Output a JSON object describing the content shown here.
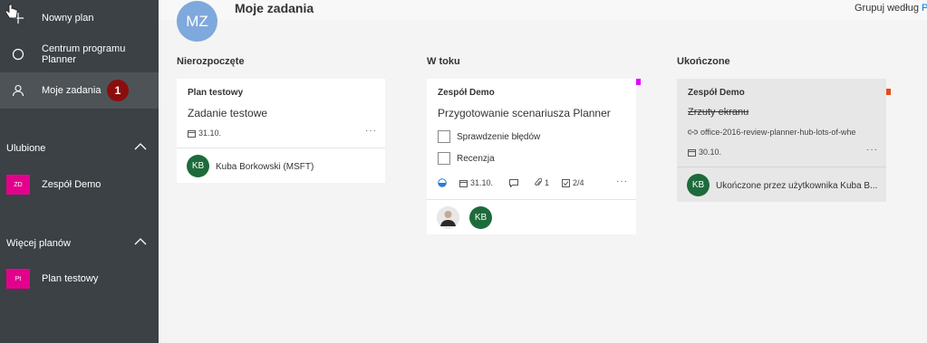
{
  "sidebar": {
    "items": [
      {
        "label": "Nowny plan",
        "icon": "plus-icon"
      },
      {
        "label": "Centrum programu Planner",
        "icon": "circle-icon"
      },
      {
        "label": "Moje zadania",
        "icon": "person-icon",
        "badge": "1"
      }
    ],
    "favorites": {
      "header": "Ulubione",
      "items": [
        {
          "label": "Zespół Demo",
          "tile": "ZD",
          "color": "#e3008c"
        }
      ]
    },
    "more_plans": {
      "header": "Więcej planów",
      "items": [
        {
          "label": "Plan testowy",
          "tile": "Pt",
          "color": "#e3008c"
        }
      ]
    }
  },
  "header": {
    "avatar": "MZ",
    "title": "Moje zadania",
    "group_by_label": "Grupuj według",
    "group_by_value": "Po"
  },
  "columns": [
    {
      "title": "Nierozpoczęte",
      "card": {
        "plan": "Plan testowy",
        "title": "Zadanie testowe",
        "due": "31.10.",
        "assignee_initials": "KB",
        "assignee": "Kuba Borkowski (MSFT)"
      }
    },
    {
      "title": "W toku",
      "card": {
        "plan": "Zespół Demo",
        "title": "Przygotowanie scenariusza Planner",
        "checklist": [
          "Sprawdzenie błędów",
          "Recenzja"
        ],
        "due": "31.10.",
        "attachments": "1",
        "checklist_progress": "2/4",
        "assignee_initials": "KB",
        "label_color": "#e300ff"
      }
    },
    {
      "title": "Ukończone",
      "card": {
        "plan": "Zespół Demo",
        "title": "Zrzuty ekranu",
        "link": "office-2016-review-planner-hub-lots-of-whe",
        "due": "30.10.",
        "assignee_initials": "KB",
        "completed_by": "Ukończone przez użytkownika Kuba B...",
        "label_color": "#e8491d"
      }
    }
  ],
  "colors": {
    "sidebar": "#3b4145",
    "badge": "#8b0e0e",
    "avatar": "#1d6b3b",
    "mz": "#7fa8dc"
  }
}
